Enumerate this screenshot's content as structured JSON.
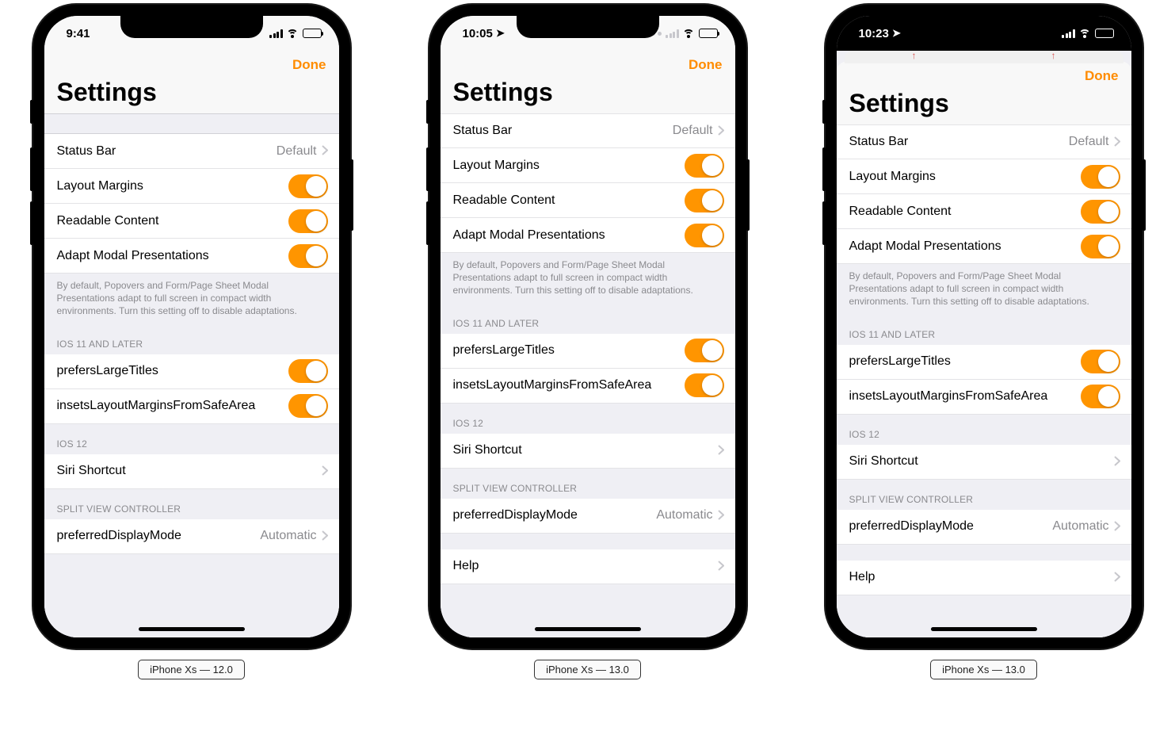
{
  "accent": "#ff9500",
  "phones": [
    {
      "caption": "iPhone Xs — 12.0",
      "sheet": false,
      "status": {
        "time": "9:41",
        "location": false,
        "dimSignal": false,
        "dots": false,
        "wifi": true,
        "batteryPct": 100
      },
      "nav": {
        "done": "Done",
        "title": "Settings"
      },
      "spacerBeforeFirst": true
    },
    {
      "caption": "iPhone Xs — 13.0",
      "sheet": false,
      "status": {
        "time": "10:05",
        "location": true,
        "dimSignal": true,
        "dots": true,
        "wifi": true,
        "batteryPct": 100
      },
      "nav": {
        "done": "Done",
        "title": "Settings"
      },
      "spacerBeforeFirst": false
    },
    {
      "caption": "iPhone Xs — 13.0",
      "sheet": true,
      "status": {
        "time": "10:23",
        "location": true,
        "dimSignal": true,
        "dots": false,
        "wifi": true,
        "batteryPct": 100
      },
      "nav": {
        "done": "Done",
        "title": "Settings"
      },
      "spacerBeforeFirst": false
    }
  ],
  "settings": {
    "rows1": [
      {
        "label": "Status Bar",
        "type": "disclosure",
        "value": "Default"
      },
      {
        "label": "Layout Margins",
        "type": "switch",
        "on": true
      },
      {
        "label": "Readable Content",
        "type": "switch",
        "on": true
      },
      {
        "label": "Adapt Modal Presentations",
        "type": "switch",
        "on": true
      }
    ],
    "footer1": "By default, Popovers and Form/Page Sheet Modal Presentations adapt to full screen in compact width environments. Turn this setting off to disable adaptations.",
    "header2": "IOS 11 AND LATER",
    "rows2": [
      {
        "label": "prefersLargeTitles",
        "type": "switch",
        "on": true
      },
      {
        "label": "insetsLayoutMarginsFromSafeArea",
        "type": "switch",
        "on": true
      }
    ],
    "header3": "IOS 12",
    "rows3": [
      {
        "label": "Siri Shortcut",
        "type": "disclosure",
        "value": ""
      }
    ],
    "header4": "SPLIT VIEW CONTROLLER",
    "rows4": [
      {
        "label": "preferredDisplayMode",
        "type": "disclosure",
        "value": "Automatic"
      }
    ],
    "rows5": [
      {
        "label": "Help",
        "type": "disclosure",
        "value": ""
      }
    ]
  }
}
